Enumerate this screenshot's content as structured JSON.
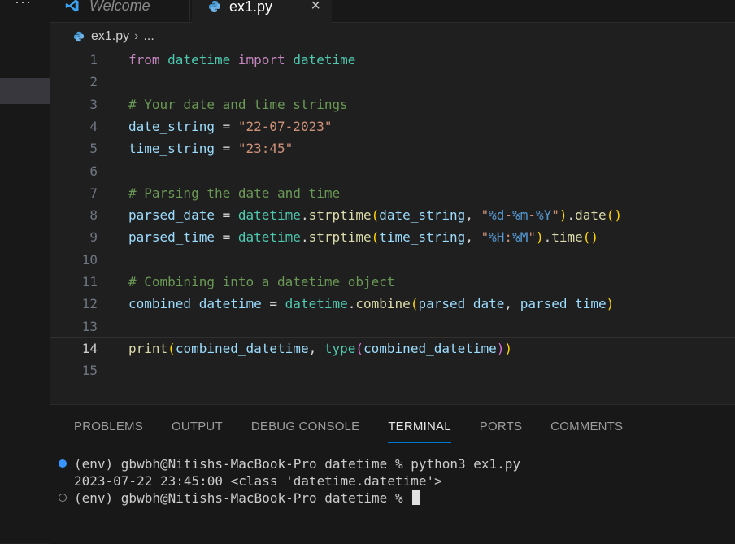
{
  "sidebar": {
    "more_label": "···"
  },
  "tabs": [
    {
      "label": "Welcome",
      "icon": "vscode-icon"
    },
    {
      "label": "ex1.py",
      "icon": "python-icon",
      "close": "×"
    }
  ],
  "breadcrumb": {
    "file": "ex1.py",
    "separator": "›",
    "more": "..."
  },
  "editor": {
    "current_line": 14,
    "lines": [
      {
        "n": "1",
        "tokens": [
          {
            "t": "from",
            "c": "kw"
          },
          {
            "t": " ",
            "c": "op"
          },
          {
            "t": "datetime",
            "c": "cls"
          },
          {
            "t": " ",
            "c": "op"
          },
          {
            "t": "import",
            "c": "kw"
          },
          {
            "t": " ",
            "c": "op"
          },
          {
            "t": "datetime",
            "c": "cls"
          }
        ]
      },
      {
        "n": "2",
        "tokens": []
      },
      {
        "n": "3",
        "tokens": [
          {
            "t": "# Your date and time strings",
            "c": "cm"
          }
        ]
      },
      {
        "n": "4",
        "tokens": [
          {
            "t": "date_string",
            "c": "var"
          },
          {
            "t": " = ",
            "c": "op"
          },
          {
            "t": "\"22-07-2023\"",
            "c": "str"
          }
        ]
      },
      {
        "n": "5",
        "tokens": [
          {
            "t": "time_string",
            "c": "var"
          },
          {
            "t": " = ",
            "c": "op"
          },
          {
            "t": "\"23:45\"",
            "c": "str"
          }
        ]
      },
      {
        "n": "6",
        "tokens": []
      },
      {
        "n": "7",
        "tokens": [
          {
            "t": "# Parsing the date and time",
            "c": "cm"
          }
        ]
      },
      {
        "n": "8",
        "tokens": [
          {
            "t": "parsed_date",
            "c": "var"
          },
          {
            "t": " = ",
            "c": "op"
          },
          {
            "t": "datetime",
            "c": "cls"
          },
          {
            "t": ".",
            "c": "op"
          },
          {
            "t": "strptime",
            "c": "fn"
          },
          {
            "t": "(",
            "c": "p1"
          },
          {
            "t": "date_string",
            "c": "var"
          },
          {
            "t": ", ",
            "c": "op"
          },
          {
            "t": "\"",
            "c": "str"
          },
          {
            "t": "%d",
            "c": "esc"
          },
          {
            "t": "-",
            "c": "str"
          },
          {
            "t": "%m",
            "c": "esc"
          },
          {
            "t": "-",
            "c": "str"
          },
          {
            "t": "%Y",
            "c": "esc"
          },
          {
            "t": "\"",
            "c": "str"
          },
          {
            "t": ")",
            "c": "p1"
          },
          {
            "t": ".",
            "c": "op"
          },
          {
            "t": "date",
            "c": "fn"
          },
          {
            "t": "()",
            "c": "p1"
          }
        ]
      },
      {
        "n": "9",
        "tokens": [
          {
            "t": "parsed_time",
            "c": "var"
          },
          {
            "t": " = ",
            "c": "op"
          },
          {
            "t": "datetime",
            "c": "cls"
          },
          {
            "t": ".",
            "c": "op"
          },
          {
            "t": "strptime",
            "c": "fn"
          },
          {
            "t": "(",
            "c": "p1"
          },
          {
            "t": "time_string",
            "c": "var"
          },
          {
            "t": ", ",
            "c": "op"
          },
          {
            "t": "\"",
            "c": "str"
          },
          {
            "t": "%H",
            "c": "esc"
          },
          {
            "t": ":",
            "c": "str"
          },
          {
            "t": "%M",
            "c": "esc"
          },
          {
            "t": "\"",
            "c": "str"
          },
          {
            "t": ")",
            "c": "p1"
          },
          {
            "t": ".",
            "c": "op"
          },
          {
            "t": "time",
            "c": "fn"
          },
          {
            "t": "()",
            "c": "p1"
          }
        ]
      },
      {
        "n": "10",
        "tokens": []
      },
      {
        "n": "11",
        "tokens": [
          {
            "t": "# Combining into a datetime object",
            "c": "cm"
          }
        ]
      },
      {
        "n": "12",
        "tokens": [
          {
            "t": "combined_datetime",
            "c": "var"
          },
          {
            "t": " = ",
            "c": "op"
          },
          {
            "t": "datetime",
            "c": "cls"
          },
          {
            "t": ".",
            "c": "op"
          },
          {
            "t": "combine",
            "c": "fn"
          },
          {
            "t": "(",
            "c": "p1"
          },
          {
            "t": "parsed_date",
            "c": "var"
          },
          {
            "t": ", ",
            "c": "op"
          },
          {
            "t": "parsed_time",
            "c": "var"
          },
          {
            "t": ")",
            "c": "p1"
          }
        ]
      },
      {
        "n": "13",
        "tokens": []
      },
      {
        "n": "14",
        "tokens": [
          {
            "t": "print",
            "c": "fn"
          },
          {
            "t": "(",
            "c": "p1"
          },
          {
            "t": "combined_datetime",
            "c": "var"
          },
          {
            "t": ", ",
            "c": "op"
          },
          {
            "t": "type",
            "c": "cls"
          },
          {
            "t": "(",
            "c": "p2"
          },
          {
            "t": "combined_datetime",
            "c": "var"
          },
          {
            "t": ")",
            "c": "p2"
          },
          {
            "t": ")",
            "c": "p1"
          }
        ]
      },
      {
        "n": "15",
        "tokens": []
      }
    ]
  },
  "panel": {
    "tabs": [
      "PROBLEMS",
      "OUTPUT",
      "DEBUG CONSOLE",
      "TERMINAL",
      "PORTS",
      "COMMENTS"
    ],
    "active_tab": "TERMINAL",
    "terminal": [
      {
        "text": "(env) gbwbh@Nitishs-MacBook-Pro datetime % python3 ex1.py",
        "marker": "filled"
      },
      {
        "text": "2023-07-22 23:45:00 <class 'datetime.datetime'>",
        "marker": "none"
      },
      {
        "text": "(env) gbwbh@Nitishs-MacBook-Pro datetime % ",
        "marker": "hollow",
        "cursor": true
      }
    ]
  },
  "colors": {
    "accent": "#0078d4",
    "background": "#1f1f1f",
    "panel": "#181818"
  }
}
